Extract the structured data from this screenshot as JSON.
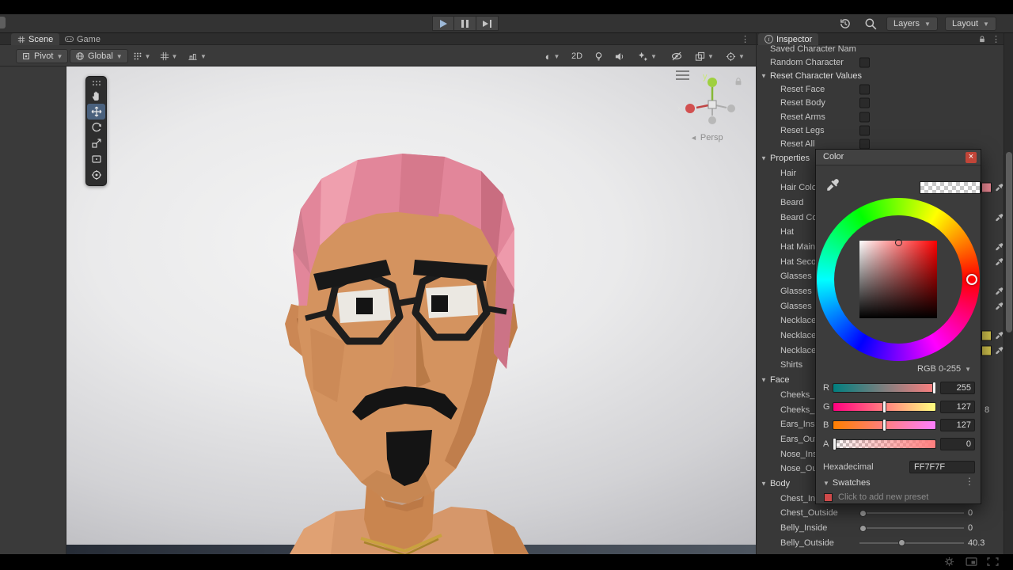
{
  "colors": {
    "hair_pink": "#e2869a",
    "skin": "#d4935f",
    "close_red": "#c14538",
    "selected_tool_blue": "#4a617d",
    "swatch_hair": "#ef8a96",
    "swatch_necklace": "#d3c44d"
  },
  "top_toolbar": {
    "layers": "Layers",
    "layout": "Layout"
  },
  "scene_pane": {
    "tabs": [
      {
        "label": "Scene"
      },
      {
        "label": "Game"
      }
    ],
    "toolbar": {
      "pivot": "Pivot",
      "global": "Global",
      "mode_2d": "2D"
    },
    "gizmo": {
      "axis_x": "x",
      "axis_y": "y",
      "persp": "Persp"
    }
  },
  "inspector": {
    "tab": "Inspector",
    "rows": [
      {
        "label": "Saved Character Nam",
        "type": "plain",
        "indent": 0
      },
      {
        "label": "Random Character",
        "type": "checkbox",
        "indent": 0
      },
      {
        "label": "Reset Character Values",
        "type": "foldout",
        "indent": 0
      },
      {
        "label": "Reset Face",
        "type": "checkbox",
        "indent": 1
      },
      {
        "label": "Reset Body",
        "type": "checkbox",
        "indent": 1
      },
      {
        "label": "Reset Arms",
        "type": "checkbox",
        "indent": 1
      },
      {
        "label": "Reset Legs",
        "type": "checkbox",
        "indent": 1
      },
      {
        "label": "Reset All",
        "type": "checkbox",
        "indent": 1
      },
      {
        "label": "Properties",
        "type": "foldout",
        "indent": 0
      },
      {
        "label": "Hair",
        "type": "plain",
        "indent": 1
      },
      {
        "label": "Hair Colo",
        "type": "color",
        "indent": 1,
        "swatch": "#ef8a96"
      },
      {
        "label": "Beard",
        "type": "plain",
        "indent": 1
      },
      {
        "label": "Beard Co",
        "type": "color",
        "indent": 1
      },
      {
        "label": "Hat",
        "type": "plain",
        "indent": 1
      },
      {
        "label": "Hat Main",
        "type": "color",
        "indent": 1
      },
      {
        "label": "Hat Seco",
        "type": "color",
        "indent": 1
      },
      {
        "label": "Glasses",
        "type": "plain",
        "indent": 1
      },
      {
        "label": "Glasses",
        "type": "color",
        "indent": 1
      },
      {
        "label": "Glasses",
        "type": "color",
        "indent": 1
      },
      {
        "label": "Necklace",
        "type": "plain",
        "indent": 1
      },
      {
        "label": "Necklace",
        "type": "color",
        "indent": 1,
        "swatch": "#d3c44d"
      },
      {
        "label": "Necklace",
        "type": "color",
        "indent": 1,
        "swatch": "#d3c44d"
      },
      {
        "label": "Shirts",
        "type": "plain",
        "indent": 1
      },
      {
        "label": "Face",
        "type": "foldout",
        "indent": 0
      },
      {
        "label": "Cheeks_",
        "type": "slider",
        "indent": 1
      },
      {
        "label": "Cheeks_",
        "type": "slider",
        "indent": 1,
        "value": "8",
        "val_pos": "outer"
      },
      {
        "label": "Ears_Insi",
        "type": "slider",
        "indent": 1
      },
      {
        "label": "Ears_Out",
        "type": "slider",
        "indent": 1
      },
      {
        "label": "Nose_Ins",
        "type": "slider",
        "indent": 1
      },
      {
        "label": "Nose_Ou",
        "type": "slider",
        "indent": 1
      },
      {
        "label": "Body",
        "type": "foldout",
        "indent": 0
      },
      {
        "label": "Chest_In",
        "type": "slider",
        "indent": 1
      },
      {
        "label": "Chest_Outside",
        "type": "slider",
        "indent": 1,
        "value": "0",
        "pos": 0
      },
      {
        "label": "Belly_Inside",
        "type": "slider",
        "indent": 1,
        "value": "0",
        "pos": 0
      },
      {
        "label": "Belly_Outside",
        "type": "slider",
        "indent": 1,
        "value": "40.3",
        "pos": 40
      }
    ]
  },
  "color_picker": {
    "title": "Color",
    "mode": "RGB 0-255",
    "sliders": [
      {
        "label": "R",
        "value": "255",
        "pos": 100,
        "from": "rgb(0,127,127)",
        "to": "rgb(255,127,127)"
      },
      {
        "label": "G",
        "value": "127",
        "pos": 50,
        "from": "rgb(255,0,127)",
        "to": "rgb(255,255,127)"
      },
      {
        "label": "B",
        "value": "127",
        "pos": 50,
        "from": "rgb(255,127,0)",
        "to": "rgb(255,127,255)"
      },
      {
        "label": "A",
        "value": "0",
        "pos": 0,
        "from": "rgba(255,127,127,0)",
        "to": "rgb(255,127,127)"
      }
    ],
    "hex_label": "Hexadecimal",
    "hex_value": "FF7F7F",
    "swatches_label": "Swatches",
    "preset_hint": "Click to add new preset"
  }
}
